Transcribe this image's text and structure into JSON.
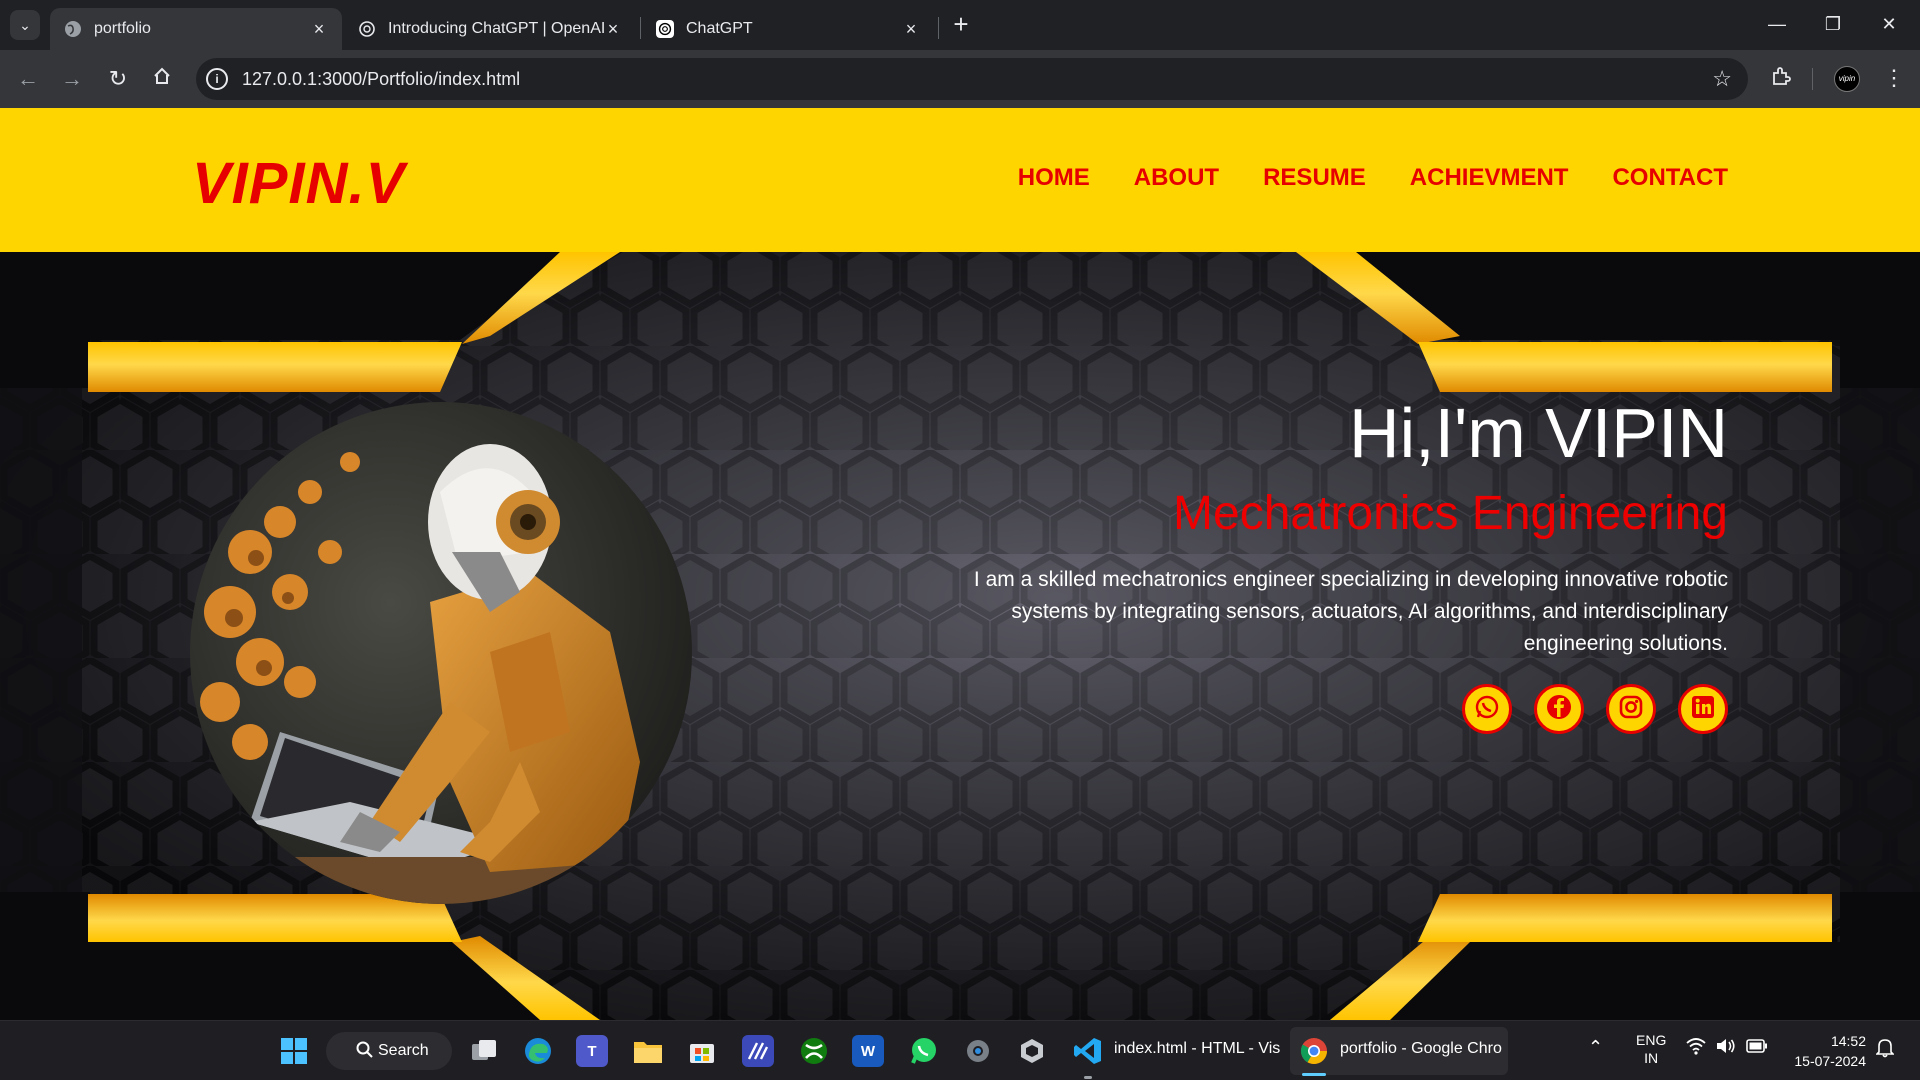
{
  "browser": {
    "tabs": [
      {
        "title": "portfolio",
        "active": true
      },
      {
        "title": "Introducing ChatGPT | OpenAI",
        "active": false
      },
      {
        "title": "ChatGPT",
        "active": false
      }
    ],
    "url": "127.0.0.1:3000/Portfolio/index.html",
    "profile_label": "vipin"
  },
  "site": {
    "logo": "VIPIN.V",
    "nav": [
      "HOME",
      "ABOUT",
      "RESUME",
      "ACHIEVMENT",
      "CONTACT"
    ],
    "greeting": "Hi,I'm VIPIN",
    "role": "Mechatronics Engineering",
    "description": "I am a skilled mechatronics engineer specializing in developing innovative robotic systems by integrating sensors, actuators, AI algorithms, and interdisciplinary engineering solutions.",
    "socials": [
      "whatsapp-icon",
      "facebook-icon",
      "instagram-icon",
      "linkedin-icon"
    ],
    "colors": {
      "header": "#ffd500",
      "accent": "#e60000",
      "frame_gold": "#f5b800"
    }
  },
  "taskbar": {
    "search_label": "Search",
    "apps": [
      "windows-start-icon",
      "task-view-icon",
      "edge-icon",
      "teams-icon",
      "file-explorer-icon",
      "store-icon",
      "mathtype-icon",
      "xbox-icon",
      "word-icon",
      "whatsapp-icon",
      "settings-icon",
      "unity-icon",
      "vscode-icon",
      "chrome-icon"
    ],
    "vscode_label": "index.html - HTML - Vis",
    "chrome_label": "portfolio - Google Chro",
    "lang_line1": "ENG",
    "lang_line2": "IN",
    "time": "14:52",
    "date": "15-07-2024"
  }
}
